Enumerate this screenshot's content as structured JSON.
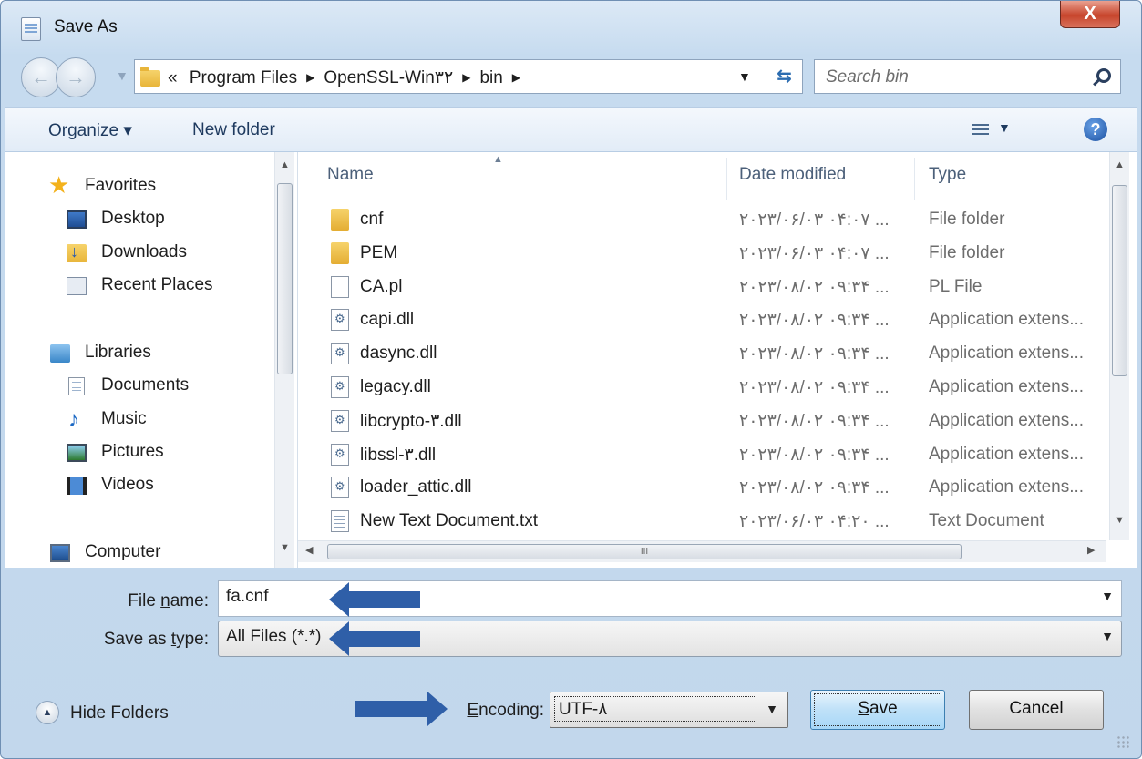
{
  "window": {
    "title": "Save As",
    "close_symbol": "X"
  },
  "nav": {
    "back_symbol": "←",
    "forward_symbol": "→"
  },
  "address": {
    "prefix": "«",
    "crumbs": [
      "Program Files",
      "OpenSSL-Win۳۲",
      "bin"
    ],
    "separator": "▶"
  },
  "search": {
    "placeholder": "Search bin"
  },
  "toolbar": {
    "organize": "Organize ▾",
    "new_folder": "New folder",
    "help": "?"
  },
  "sidebar": {
    "favorites": "Favorites",
    "items": [
      {
        "label": "Desktop",
        "icon": "desktop-icon"
      },
      {
        "label": "Downloads",
        "icon": "downloads-icon"
      },
      {
        "label": "Recent Places",
        "icon": "recent-places-icon"
      }
    ],
    "libraries": "Libraries",
    "library_items": [
      {
        "label": "Documents",
        "icon": "documents-icon"
      },
      {
        "label": "Music",
        "icon": "music-icon"
      },
      {
        "label": "Pictures",
        "icon": "pictures-icon"
      },
      {
        "label": "Videos",
        "icon": "videos-icon"
      }
    ],
    "computer": "Computer"
  },
  "columns": {
    "name": "Name",
    "date": "Date modified",
    "type": "Type"
  },
  "files": [
    {
      "name": "cnf",
      "date": "۲۰۲۳/۰۶/۰۳ ۰۴:۰۷ ...",
      "type": "File folder",
      "kind": "folder"
    },
    {
      "name": "PEM",
      "date": "۲۰۲۳/۰۶/۰۳ ۰۴:۰۷ ...",
      "type": "File folder",
      "kind": "folder"
    },
    {
      "name": "CA.pl",
      "date": "۲۰۲۳/۰۸/۰۲ ۰۹:۳۴ ...",
      "type": "PL File",
      "kind": "file"
    },
    {
      "name": "capi.dll",
      "date": "۲۰۲۳/۰۸/۰۲ ۰۹:۳۴ ...",
      "type": "Application extens...",
      "kind": "dll"
    },
    {
      "name": "dasync.dll",
      "date": "۲۰۲۳/۰۸/۰۲ ۰۹:۳۴ ...",
      "type": "Application extens...",
      "kind": "dll"
    },
    {
      "name": "legacy.dll",
      "date": "۲۰۲۳/۰۸/۰۲ ۰۹:۳۴ ...",
      "type": "Application extens...",
      "kind": "dll"
    },
    {
      "name": "libcrypto-۳.dll",
      "date": "۲۰۲۳/۰۸/۰۲ ۰۹:۳۴ ...",
      "type": "Application extens...",
      "kind": "dll"
    },
    {
      "name": "libssl-۳.dll",
      "date": "۲۰۲۳/۰۸/۰۲ ۰۹:۳۴ ...",
      "type": "Application extens...",
      "kind": "dll"
    },
    {
      "name": "loader_attic.dll",
      "date": "۲۰۲۳/۰۸/۰۲ ۰۹:۳۴ ...",
      "type": "Application extens...",
      "kind": "dll"
    },
    {
      "name": "New Text Document.txt",
      "date": "۲۰۲۳/۰۶/۰۳ ۰۴:۲۰ ...",
      "type": "Text Document",
      "kind": "txt"
    }
  ],
  "form": {
    "file_name_label_pre": "File ",
    "file_name_label_u": "n",
    "file_name_label_post": "ame:",
    "file_name_value": "fa.cnf",
    "type_label_pre": "Save as ",
    "type_label_u": "t",
    "type_label_post": "ype:",
    "type_value": "All Files  (*.*)",
    "encoding_label_u": "E",
    "encoding_label_post": "ncoding:",
    "encoding_value": "UTF-۸"
  },
  "buttons": {
    "hide_folders": "Hide Folders",
    "save_u": "S",
    "save_rest": "ave",
    "cancel": "Cancel"
  }
}
